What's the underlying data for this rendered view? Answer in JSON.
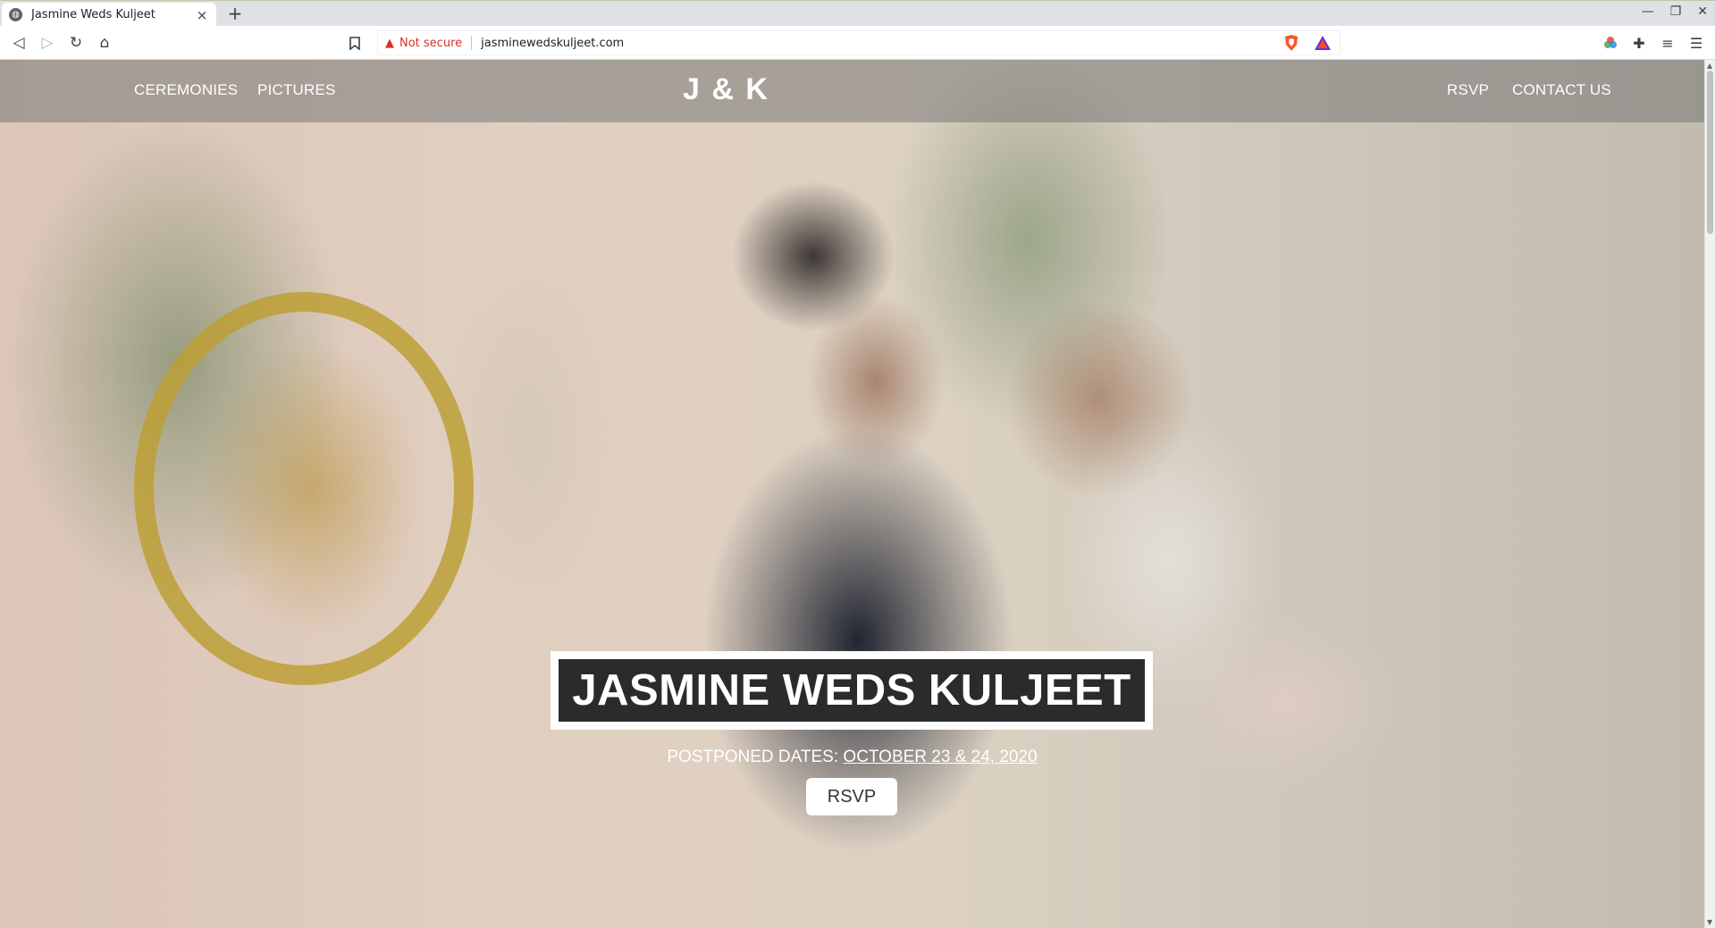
{
  "browser": {
    "tab_title": "Jasmine Weds Kuljeet",
    "new_tab_glyph": "+",
    "tab_close_glyph": "×",
    "security_text": "Not secure",
    "url": "jasminewedskuljeet.com",
    "icons": [
      "back-icon",
      "forward-icon",
      "reload-icon",
      "home-icon",
      "bookmark-icon",
      "warning-icon",
      "brave-shield-icon",
      "brave-rewards-icon",
      "color-wheel-icon",
      "extensions-icon",
      "playlist-icon",
      "menu-icon",
      "minimize-icon",
      "restore-icon",
      "close-icon"
    ]
  },
  "site": {
    "nav": {
      "left": [
        "CEREMONIES",
        "PICTURES"
      ],
      "brand": "J & K",
      "right": [
        "RSVP",
        "CONTACT US"
      ]
    },
    "hero": {
      "headline": "JASMINE WEDS KULJEET",
      "dates_prefix": "POSTPONED DATES: ",
      "dates_link": "OCTOBER 23 & 24, 2020",
      "button": "RSVP"
    }
  },
  "colors": {
    "accent_warning": "#d93025",
    "nav_overlay": "rgba(120,120,120,0.55)",
    "headline_box_bg": "#2b2b2b"
  }
}
